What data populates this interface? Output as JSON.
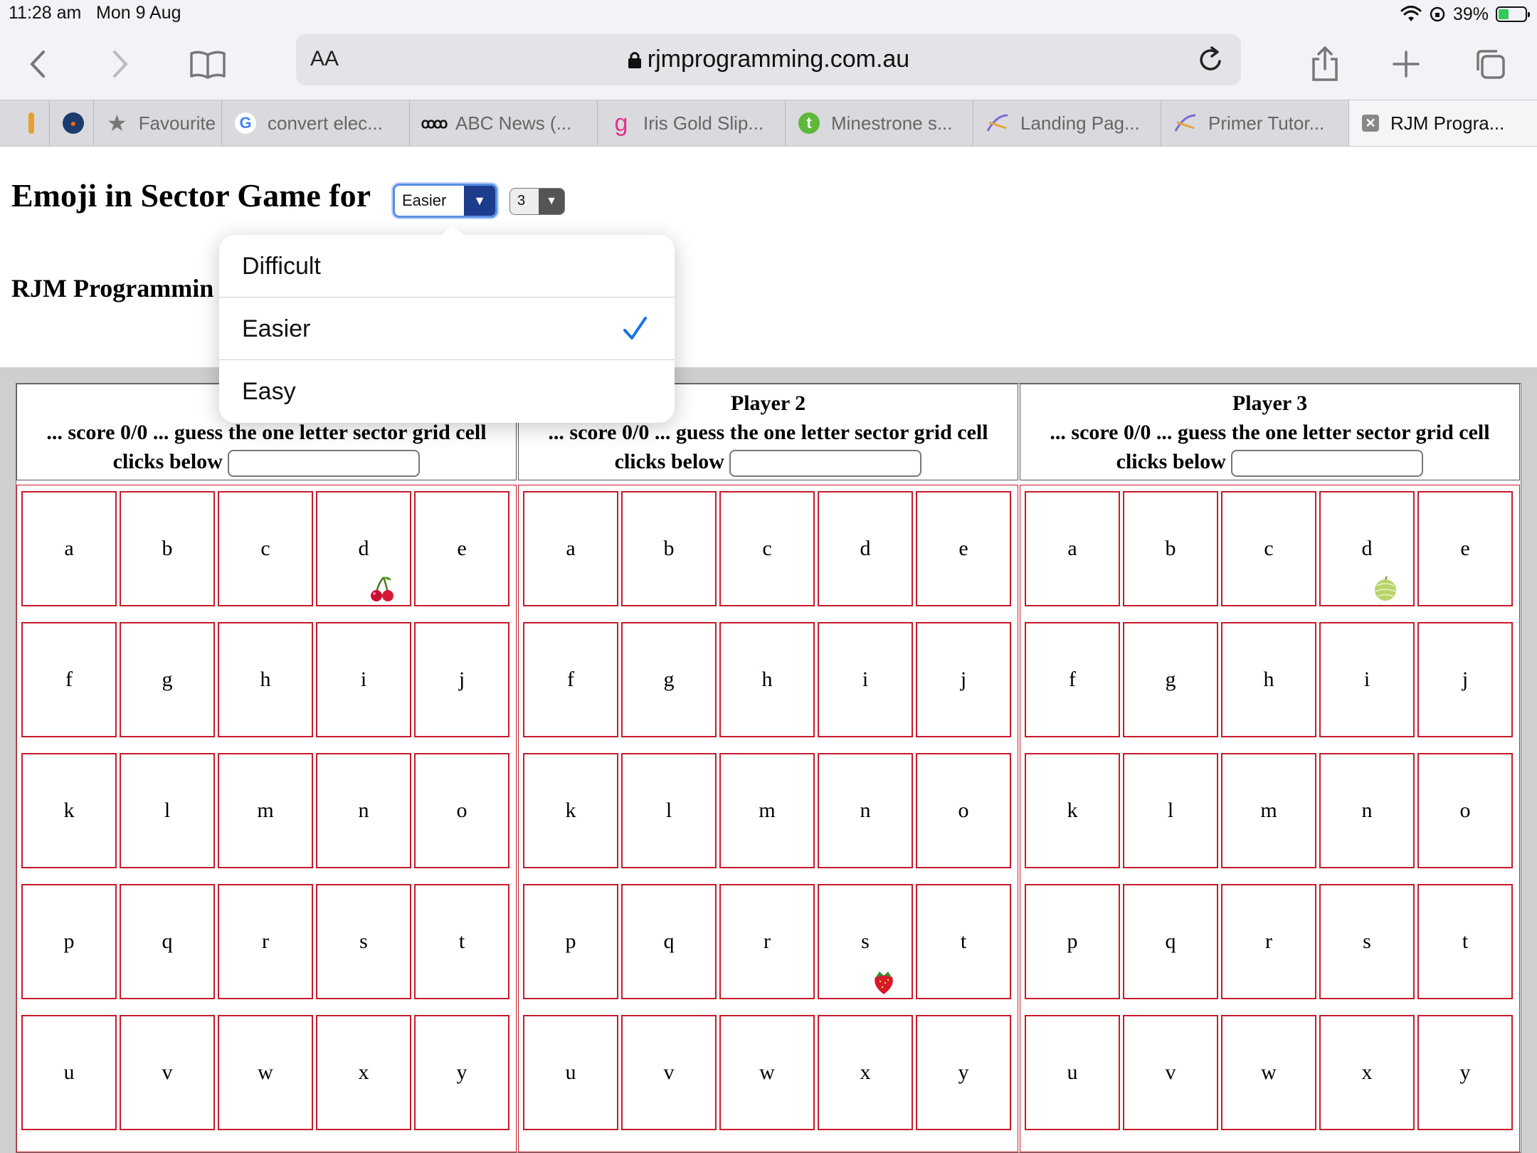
{
  "status_bar": {
    "time": "11:28 am",
    "date": "Mon 9 Aug",
    "battery_text": "39%",
    "battery_level": 0.39
  },
  "browser": {
    "url_aa": "AA",
    "host": "rjmprogramming.com.au",
    "tabs": [
      {
        "label": "",
        "icon": "page-icon"
      },
      {
        "label": "",
        "icon": "app-icon"
      },
      {
        "label": "Favourite",
        "icon": "star-icon"
      },
      {
        "label": "convert elec...",
        "icon": "google-icon"
      },
      {
        "label": "ABC News (...",
        "icon": "abc-icon"
      },
      {
        "label": "Iris Gold Slip...",
        "icon": "g-icon"
      },
      {
        "label": "Minestrone s...",
        "icon": "t-icon"
      },
      {
        "label": "Landing Pag...",
        "icon": "rjm-icon"
      },
      {
        "label": "Primer Tutor...",
        "icon": "rjm-icon"
      },
      {
        "label": "RJM Progra...",
        "icon": "close-icon",
        "active": true
      }
    ]
  },
  "page": {
    "title": "Emoji in Sector Game for",
    "difficulty_value": "Easier",
    "players_value": "3",
    "subtitle": "RJM Programmin"
  },
  "dropdown": {
    "options": [
      "Difficult",
      "Easier",
      "Easy"
    ],
    "selected": "Easier"
  },
  "players": [
    {
      "name": "",
      "status": "... score 0/0 ... guess the one letter sector grid cell",
      "clicks": "clicks below"
    },
    {
      "name": "Player 2",
      "status": "... score 0/0 ... guess the one letter sector grid cell",
      "clicks": "clicks below"
    },
    {
      "name": "Player 3",
      "status": "... score 0/0 ... guess the one letter sector grid cell",
      "clicks": "clicks below"
    }
  ],
  "grid_letters": [
    "a",
    "b",
    "c",
    "d",
    "e",
    "f",
    "g",
    "h",
    "i",
    "j",
    "k",
    "l",
    "m",
    "n",
    "o",
    "p",
    "q",
    "r",
    "s",
    "t",
    "u",
    "v",
    "w",
    "x",
    "y"
  ],
  "emojis": [
    {
      "player": 0,
      "cell": "d",
      "emoji": "cherries"
    },
    {
      "player": 1,
      "cell": "s",
      "emoji": "strawberry"
    },
    {
      "player": 2,
      "cell": "d",
      "emoji": "melon"
    }
  ],
  "colors": {
    "grid_border": "#c71b2c",
    "select_accent": "#1e3c8c",
    "check": "#1a73e8"
  }
}
